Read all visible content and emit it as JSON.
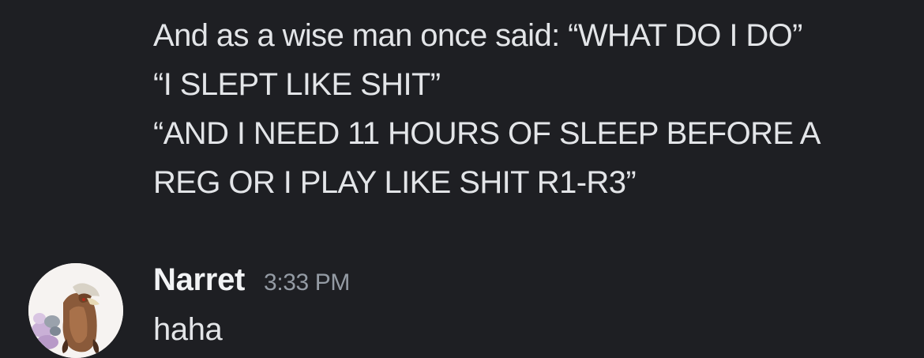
{
  "previous_message": {
    "lines": [
      "And as a wise man once said: “WHAT DO I DO”",
      "“I SLEPT LIKE SHIT”",
      "“AND I NEED 11 HOURS OF SLEEP BEFORE A",
      "REG OR I PLAY LIKE SHIT R1-R3”"
    ]
  },
  "message": {
    "username": "Narret",
    "timestamp": "3:33 PM",
    "text": "haha",
    "avatar_icon": "pokemon-entei-avatar-icon"
  },
  "colors": {
    "background": "#1e1f23",
    "message_text": "#e3e5e8",
    "username": "#f2f3f5",
    "timestamp": "#949ba4"
  }
}
